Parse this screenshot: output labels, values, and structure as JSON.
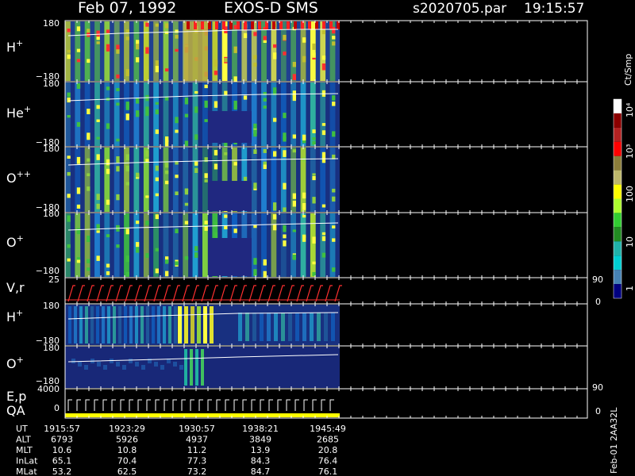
{
  "header": {
    "date": "Feb 07, 1992",
    "instrument": "EXOS-D SMS",
    "file": "s2020705.par",
    "time": "19:15:57"
  },
  "colorbar": {
    "unit": "Ct/Smp",
    "tick_labels": [
      "10⁴",
      "10³",
      "100",
      "10",
      "1"
    ],
    "colors": [
      "#ffffff",
      "#8b0000",
      "#b22222",
      "#ff0000",
      "#8b7d3a",
      "#bdb76b",
      "#ffff00",
      "#adff2f",
      "#32cd32",
      "#228b22",
      "#20b2aa",
      "#00ced1",
      "#4682b4",
      "#000080"
    ]
  },
  "vertical_label": "Feb-01 2AA32L",
  "panels": [
    {
      "label": "H",
      "sup": "+",
      "ymax": "180",
      "ymin": "−180"
    },
    {
      "label": "He",
      "sup": "+",
      "ymax": "180",
      "ymin": "−180"
    },
    {
      "label": "O",
      "sup": "++",
      "ymax": "180",
      "ymin": "−180"
    },
    {
      "label": "O",
      "sup": "+",
      "ymax": "180",
      "ymin": "−180"
    },
    {
      "label": "V,r",
      "sup": "",
      "ymax": "25",
      "ymin": "",
      "right_top": "90",
      "right_bottom": "0"
    },
    {
      "label": "H",
      "sup": "+",
      "ymax": "180",
      "ymin": "−180"
    },
    {
      "label": "O",
      "sup": "+",
      "ymax": "180",
      "ymin": "−180"
    },
    {
      "label": "E,p",
      "label2": "QA",
      "sup": "",
      "ymax": "4000",
      "ymin": "0",
      "right_top": "90",
      "right_bottom": "0"
    }
  ],
  "chart_data": {
    "type": "heatmap",
    "xlabel": "UT",
    "x_ticks": [
      "1915:57",
      "1923:29",
      "1930:57",
      "1938:21",
      "1945:49"
    ],
    "orbit_rows": [
      {
        "name": "UT",
        "values": [
          "1915:57",
          "1923:29",
          "1930:57",
          "1938:21",
          "1945:49"
        ]
      },
      {
        "name": "ALT",
        "values": [
          "6793",
          "5926",
          "4937",
          "3849",
          "2685"
        ]
      },
      {
        "name": "MLT",
        "values": [
          "10.6",
          "10.8",
          "11.2",
          "13.9",
          "20.8"
        ]
      },
      {
        "name": "InLat",
        "values": [
          "65.1",
          "70.4",
          "77.3",
          "84.3",
          "76.4"
        ]
      },
      {
        "name": "MLat",
        "values": [
          "53.2",
          "62.5",
          "73.2",
          "84.7",
          "76.1"
        ]
      }
    ]
  }
}
